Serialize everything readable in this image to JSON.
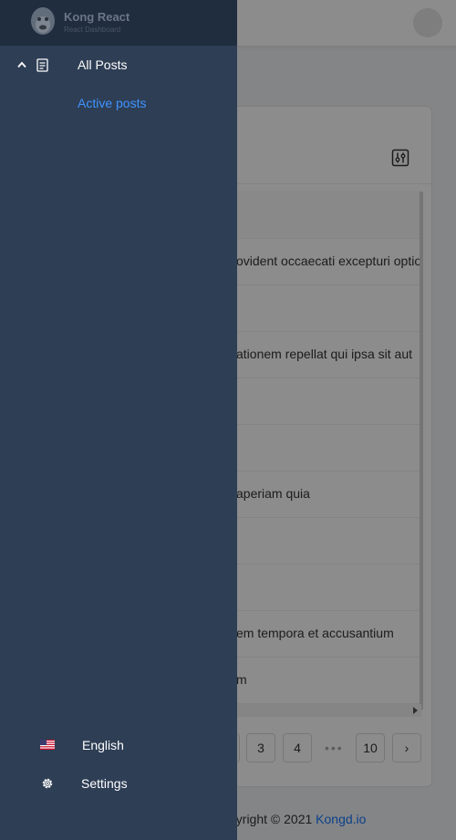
{
  "app": {
    "logo_title": "Kong React",
    "logo_subtitle": "React Dashboard"
  },
  "sidebar": {
    "menu": {
      "label": "All Posts",
      "icon": "document-icon",
      "expand_icon": "chevron-up-icon",
      "children": [
        {
          "label": "Active posts"
        }
      ]
    },
    "bottom": {
      "language": {
        "label": "English",
        "icon": "us-flag-icon"
      },
      "settings": {
        "label": "Settings",
        "icon": "gear-icon"
      }
    }
  },
  "table": {
    "rows": [
      "ovident occaecati excepturi optio",
      "",
      "ationem repellat qui ipsa sit aut",
      "",
      "",
      "aperiam quia",
      "",
      "",
      "em tempora et accusantium",
      "m"
    ]
  },
  "pagination": {
    "pages": [
      "3",
      "4",
      "10"
    ],
    "ellipsis": "•••",
    "next": "›"
  },
  "footer": {
    "text": "pyright © 2021 ",
    "link": "Kongd.io"
  },
  "colors": {
    "drawer_bg": "#2e3e55",
    "active_link": "#3f95ff"
  }
}
